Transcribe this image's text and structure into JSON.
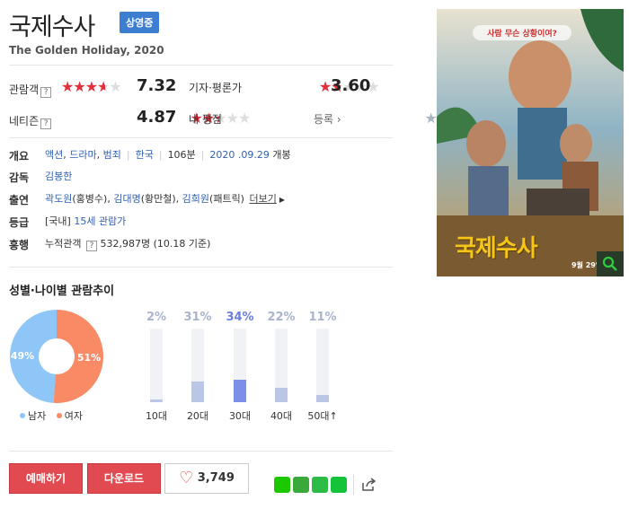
{
  "movie": {
    "title": "국제수사",
    "status_badge": "상영중",
    "subtitle": "The Golden Holiday, 2020"
  },
  "ratings": {
    "audience": {
      "label": "관람객",
      "help": "?",
      "score": "7.32",
      "fraction": 0.732
    },
    "critic": {
      "label": "기자·평론가",
      "score": "3.60",
      "fraction": 0.36
    },
    "netizen": {
      "label": "네티즌",
      "help": "?",
      "score": "4.87",
      "fraction": 0.487
    },
    "my": {
      "label": "내 평점",
      "register": "등록"
    }
  },
  "info": {
    "overview": {
      "label": "개요",
      "genres": [
        "액션",
        "드라마",
        "범죄"
      ],
      "country": "한국",
      "runtime": "106분",
      "release_date": "2020 .09.29",
      "release_suffix": "개봉"
    },
    "director": {
      "label": "감독",
      "name": "김봉한"
    },
    "cast": {
      "label": "출연",
      "actors": [
        {
          "name": "곽도원",
          "role": "(홍병수)"
        },
        {
          "name": "김대명",
          "role": "(황만철)"
        },
        {
          "name": "김희원",
          "role": "(패트릭)"
        }
      ],
      "more": "더보기"
    },
    "rating": {
      "label": "등급",
      "region": "[국내]",
      "value": "15세 관람가"
    },
    "boxoffice": {
      "label": "흥행",
      "name": "누적관객",
      "help": "?",
      "value": "532,987명",
      "note": "(10.18 기준)"
    }
  },
  "chart_data": {
    "type": "bar",
    "title": "성별·나이별 관람추이",
    "gender": {
      "type": "pie",
      "slices": [
        {
          "name": "남자",
          "value": 49,
          "label": "49%",
          "color": "#8ec7f7"
        },
        {
          "name": "여자",
          "value": 51,
          "label": "51%",
          "color": "#f88a66"
        }
      ]
    },
    "age": {
      "categories": [
        "10대",
        "20대",
        "30대",
        "40대",
        "50대↑"
      ],
      "values": [
        2,
        31,
        34,
        22,
        11
      ],
      "labels": [
        "2%",
        "31%",
        "34%",
        "22%",
        "11%"
      ],
      "highlight_index": 2,
      "ylim": [
        0,
        100
      ]
    }
  },
  "actions": {
    "reserve": "예매하기",
    "download": "다운로드",
    "like_count": "3,749"
  },
  "poster": {
    "tagline": "사람 무슨 상황이여?",
    "title": "국제수사",
    "release": "9월 29일 대",
    "colors": {
      "sky": "#7ba2b8",
      "sand": "#c89a55",
      "title": "#f5c518"
    }
  },
  "colors": {
    "accent_red": "#e12f3b",
    "badge_blue": "#3e7ed1",
    "link_blue": "#3060b0"
  }
}
